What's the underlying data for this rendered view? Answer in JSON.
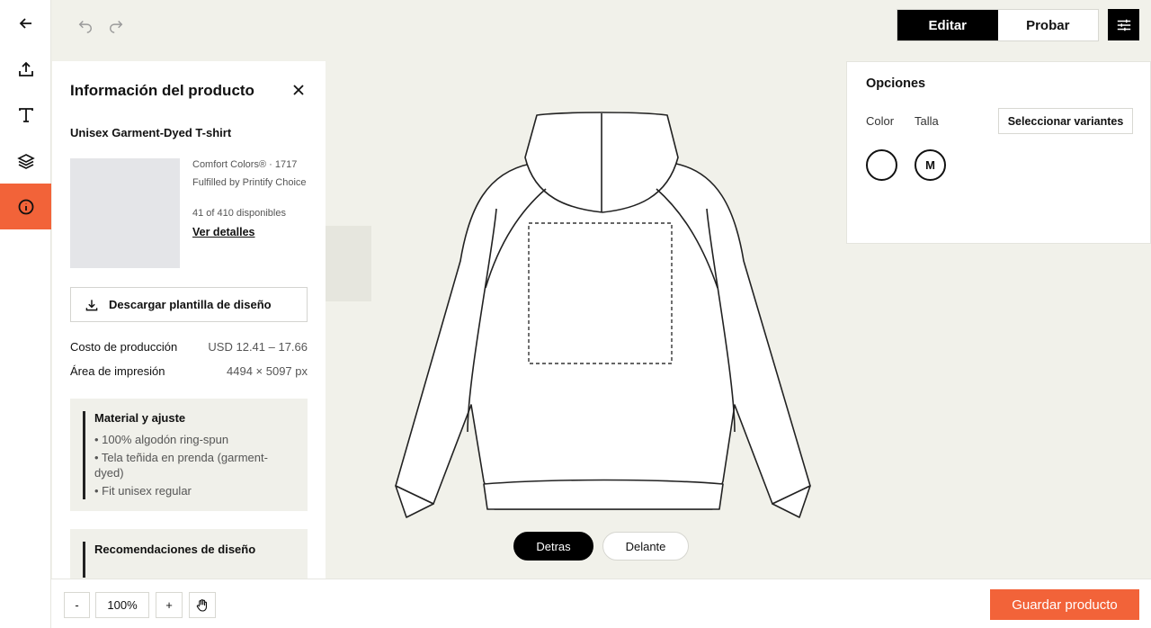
{
  "toolbar": {
    "mode_edit": "Editar",
    "mode_preview": "Probar"
  },
  "panel": {
    "title": "Información del producto",
    "product_name": "Unisex Garment-Dyed T-shirt",
    "brand": "Comfort Colors® · 1717",
    "fulfilled": "Fulfilled by Printify Choice",
    "stock": "41 of 410 disponibles",
    "details_link": "Ver detalles",
    "download_label": "Descargar plantilla de diseño",
    "cost_label": "Costo de producción",
    "cost_value": "USD 12.41 – 17.66",
    "area_label": "Área de impresión",
    "area_value": "4494 × 5097 px",
    "material": {
      "title": "Material y ajuste",
      "items": [
        "• 100% algodón ring-spun",
        "• Tela teñida en prenda (garment-dyed)",
        "• Fit unisex regular"
      ]
    },
    "recommendations_title": "Recomendaciones de diseño"
  },
  "canvas": {
    "back_label": "Detras",
    "front_label": "Delante"
  },
  "options": {
    "title": "Opciones",
    "color_label": "Color",
    "size_label": "Talla",
    "variants_button": "Seleccionar variantes",
    "size_value": "M",
    "color_value": "#ffffff"
  },
  "bottom": {
    "zoom_minus": "-",
    "zoom_value": "100%",
    "zoom_plus": "+",
    "save_label": "Guardar producto"
  },
  "colors": {
    "accent": "#f26339",
    "canvas_bg": "#f1f1ea"
  }
}
